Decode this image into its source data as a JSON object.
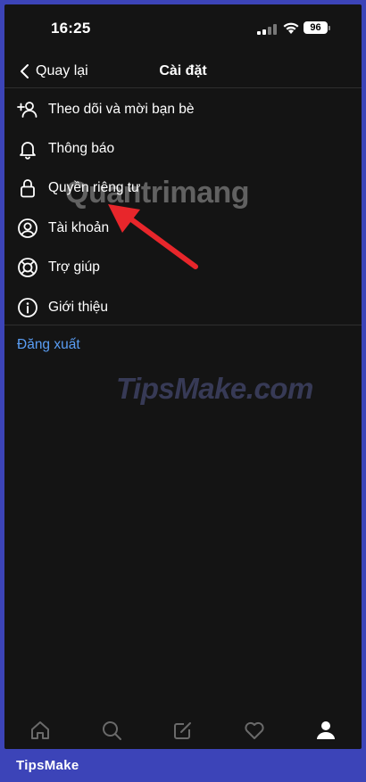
{
  "status_bar": {
    "time": "16:25",
    "battery": "96",
    "icons": [
      "signal-icon",
      "wifi-icon",
      "battery-icon"
    ]
  },
  "header": {
    "back_label": "Quay lại",
    "title": "Cài đặt"
  },
  "menu": {
    "items": [
      {
        "label": "Theo dõi và mời bạn bè",
        "icon": "add-person-icon"
      },
      {
        "label": "Thông báo",
        "icon": "bell-icon"
      },
      {
        "label": "Quyền riêng tư",
        "icon": "lock-icon"
      },
      {
        "label": "Tài khoản",
        "icon": "account-circle-icon"
      },
      {
        "label": "Trợ giúp",
        "icon": "lifebuoy-icon"
      },
      {
        "label": "Giới thiệu",
        "icon": "info-icon"
      }
    ],
    "logout_label": "Đăng xuất"
  },
  "tab_bar": {
    "tabs": [
      "home-icon",
      "search-icon",
      "compose-icon",
      "heart-icon",
      "profile-icon"
    ]
  },
  "watermarks": {
    "quantrimang": "Quantrimang",
    "tipsmake": "TipsMake.com"
  },
  "footer": {
    "brand": "TipsMake"
  },
  "colors": {
    "background": "#141414",
    "frame": "#3c44b8",
    "link": "#5a9ef5",
    "arrow": "#e8262b"
  }
}
